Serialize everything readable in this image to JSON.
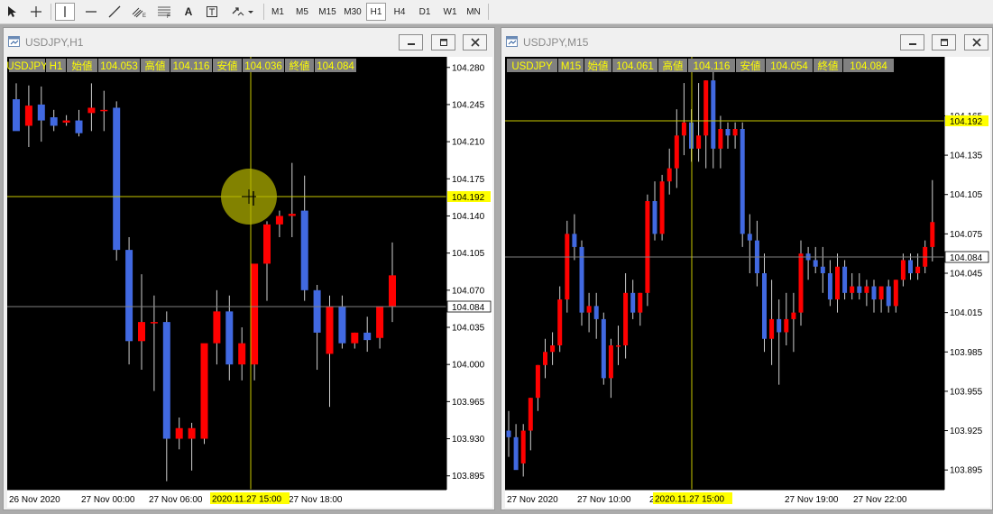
{
  "toolbar": {
    "timeframes": [
      "M1",
      "M5",
      "M15",
      "M30",
      "H1",
      "H4",
      "D1",
      "W1",
      "MN"
    ],
    "selected_timeframe": "H1",
    "text_tool_label": "A"
  },
  "colors": {
    "chart_bg": "#000000",
    "bull": "#ff0000",
    "bear": "#4169e1",
    "wick": "#d0d0d0",
    "axis_text": "#ffffff",
    "grid_line": "#808080",
    "crosshair": "#c8c800",
    "highlight_label": "#ffff00",
    "ohlc_bg": "#808080",
    "ohlc_text": "#ffff00"
  },
  "windows": [
    {
      "title": "USDJPY,H1",
      "ohlc": [
        "USDJPY",
        "H1",
        "始値",
        "104.053",
        "高値",
        "104.116",
        "安値",
        "104.036",
        "終値",
        "104.084"
      ],
      "price_labels": [
        "104.280",
        "104.245",
        "104.210",
        "104.175",
        "104.140",
        "104.105",
        "104.070",
        "104.035",
        "104.000",
        "103.965",
        "103.930",
        "103.895"
      ],
      "price_range": [
        103.882,
        104.29
      ],
      "time_labels": [
        "26 Nov 2020",
        "27 Nov 00:00",
        "27 Nov 06:00",
        "27 Nov 18:00"
      ],
      "crosshair_price": "104.192",
      "crosshair_time": "2020.11.27 15:00",
      "current_price": "104.084",
      "candles": [
        [
          104.25,
          104.265,
          104.23,
          104.22
        ],
        [
          104.225,
          104.263,
          104.205,
          104.244
        ],
        [
          104.245,
          104.262,
          104.21,
          104.23
        ],
        [
          104.233,
          104.24,
          104.22,
          104.225
        ],
        [
          104.228,
          104.235,
          104.225,
          104.23
        ],
        [
          104.23,
          104.24,
          104.215,
          104.218
        ],
        [
          104.237,
          104.265,
          104.22,
          104.242
        ],
        [
          104.24,
          104.258,
          104.22,
          104.24
        ],
        [
          104.242,
          104.248,
          104.098,
          104.108
        ],
        [
          104.108,
          104.12,
          104.0,
          104.022
        ],
        [
          104.022,
          104.085,
          103.995,
          104.04
        ],
        [
          104.04,
          104.065,
          103.975,
          104.04
        ],
        [
          104.04,
          104.05,
          103.89,
          103.93
        ],
        [
          103.93,
          103.95,
          103.92,
          103.94
        ],
        [
          103.93,
          103.945,
          103.9,
          103.94
        ],
        [
          103.93,
          104.0,
          103.925,
          104.02
        ],
        [
          104.02,
          104.07,
          104.0,
          104.05
        ],
        [
          104.05,
          104.065,
          103.985,
          104.0
        ],
        [
          104.0,
          104.035,
          103.985,
          104.02
        ],
        [
          104.0,
          104.09,
          103.985,
          104.095
        ],
        [
          104.095,
          104.135,
          104.06,
          104.132
        ],
        [
          104.132,
          104.145,
          104.12,
          104.14
        ],
        [
          104.14,
          104.19,
          104.12,
          104.142
        ],
        [
          104.145,
          104.178,
          104.06,
          104.07
        ],
        [
          104.07,
          104.075,
          103.995,
          104.03
        ],
        [
          104.01,
          104.065,
          103.96,
          104.055
        ],
        [
          104.055,
          104.065,
          104.015,
          104.02
        ],
        [
          104.02,
          104.03,
          104.015,
          104.03
        ],
        [
          104.03,
          104.045,
          104.012,
          104.023
        ],
        [
          104.025,
          104.05,
          104.015,
          104.055
        ],
        [
          104.055,
          104.115,
          104.04,
          104.084
        ]
      ]
    },
    {
      "title": "USDJPY,M15",
      "ohlc": [
        "USDJPY",
        "M15",
        "始値",
        "104.061",
        "高値",
        "104.116",
        "安値",
        "104.054",
        "終値",
        "104.084"
      ],
      "price_labels": [
        "104.165",
        "104.135",
        "104.105",
        "104.075",
        "104.045",
        "104.015",
        "103.985",
        "103.955",
        "103.925",
        "103.895"
      ],
      "price_range": [
        103.88,
        104.21
      ],
      "time_labels": [
        "27 Nov 2020",
        "27 Nov 10:00",
        "27 Nov 16:00",
        "27 Nov 19:00",
        "27 Nov 22:00"
      ],
      "crosshair_price": "104.192",
      "crosshair_time": "2020.11.27 15:00",
      "current_price": "104.084",
      "candles": [
        [
          103.925,
          103.94,
          103.905,
          103.92
        ],
        [
          103.92,
          103.93,
          103.9,
          103.895
        ],
        [
          103.9,
          103.93,
          103.89,
          103.925
        ],
        [
          103.925,
          103.95,
          103.91,
          103.95
        ],
        [
          103.95,
          103.975,
          103.94,
          103.975
        ],
        [
          103.975,
          103.995,
          103.965,
          103.985
        ],
        [
          103.985,
          104.0,
          103.975,
          103.99
        ],
        [
          103.99,
          104.035,
          103.985,
          104.025
        ],
        [
          104.025,
          104.085,
          104.015,
          104.075
        ],
        [
          104.075,
          104.09,
          104.055,
          104.065
        ],
        [
          104.065,
          104.07,
          104.005,
          104.015
        ],
        [
          104.015,
          104.03,
          104.0,
          104.02
        ],
        [
          104.02,
          104.03,
          103.995,
          104.01
        ],
        [
          104.01,
          104.015,
          103.96,
          103.965
        ],
        [
          103.965,
          103.995,
          103.95,
          103.99
        ],
        [
          103.99,
          104.005,
          103.975,
          103.99
        ],
        [
          103.99,
          104.045,
          103.98,
          104.03
        ],
        [
          104.03,
          104.04,
          104.01,
          104.015
        ],
        [
          104.015,
          104.03,
          104.005,
          104.03
        ],
        [
          104.03,
          104.105,
          104.02,
          104.1
        ],
        [
          104.1,
          104.115,
          104.07,
          104.075
        ],
        [
          104.075,
          104.12,
          104.07,
          104.115
        ],
        [
          104.115,
          104.14,
          104.105,
          104.125
        ],
        [
          104.125,
          104.17,
          104.11,
          104.15
        ],
        [
          104.15,
          104.19,
          104.135,
          104.16
        ],
        [
          104.16,
          104.17,
          104.13,
          104.14
        ],
        [
          104.14,
          104.19,
          104.13,
          104.15
        ],
        [
          104.15,
          104.192,
          104.125,
          104.192
        ],
        [
          104.192,
          104.2,
          104.125,
          104.14
        ],
        [
          104.14,
          104.165,
          104.125,
          104.155
        ],
        [
          104.155,
          104.16,
          104.14,
          104.15
        ],
        [
          104.15,
          104.16,
          104.14,
          104.155
        ],
        [
          104.155,
          104.16,
          104.065,
          104.075
        ],
        [
          104.075,
          104.09,
          104.045,
          104.07
        ],
        [
          104.07,
          104.085,
          104.035,
          104.045
        ],
        [
          104.045,
          104.06,
          103.985,
          103.995
        ],
        [
          103.995,
          104.04,
          103.975,
          104.01
        ],
        [
          104.01,
          104.025,
          103.96,
          104.0
        ],
        [
          104.0,
          104.03,
          103.99,
          104.01
        ],
        [
          104.01,
          104.03,
          103.985,
          104.015
        ],
        [
          104.015,
          104.07,
          104.005,
          104.06
        ],
        [
          104.06,
          104.065,
          104.04,
          104.055
        ],
        [
          104.055,
          104.065,
          104.045,
          104.05
        ],
        [
          104.05,
          104.065,
          104.03,
          104.045
        ],
        [
          104.045,
          104.055,
          104.02,
          104.025
        ],
        [
          104.025,
          104.06,
          104.015,
          104.05
        ],
        [
          104.05,
          104.055,
          104.025,
          104.03
        ],
        [
          104.03,
          104.045,
          104.025,
          104.035
        ],
        [
          104.035,
          104.045,
          104.025,
          104.03
        ],
        [
          104.03,
          104.04,
          104.02,
          104.035
        ],
        [
          104.035,
          104.04,
          104.015,
          104.025
        ],
        [
          104.025,
          104.035,
          104.015,
          104.035
        ],
        [
          104.035,
          104.04,
          104.015,
          104.02
        ],
        [
          104.02,
          104.04,
          104.015,
          104.04
        ],
        [
          104.04,
          104.06,
          104.035,
          104.055
        ],
        [
          104.055,
          104.06,
          104.04,
          104.045
        ],
        [
          104.045,
          104.06,
          104.04,
          104.05
        ],
        [
          104.05,
          104.07,
          104.045,
          104.065
        ],
        [
          104.065,
          104.116,
          104.054,
          104.084
        ]
      ]
    }
  ]
}
